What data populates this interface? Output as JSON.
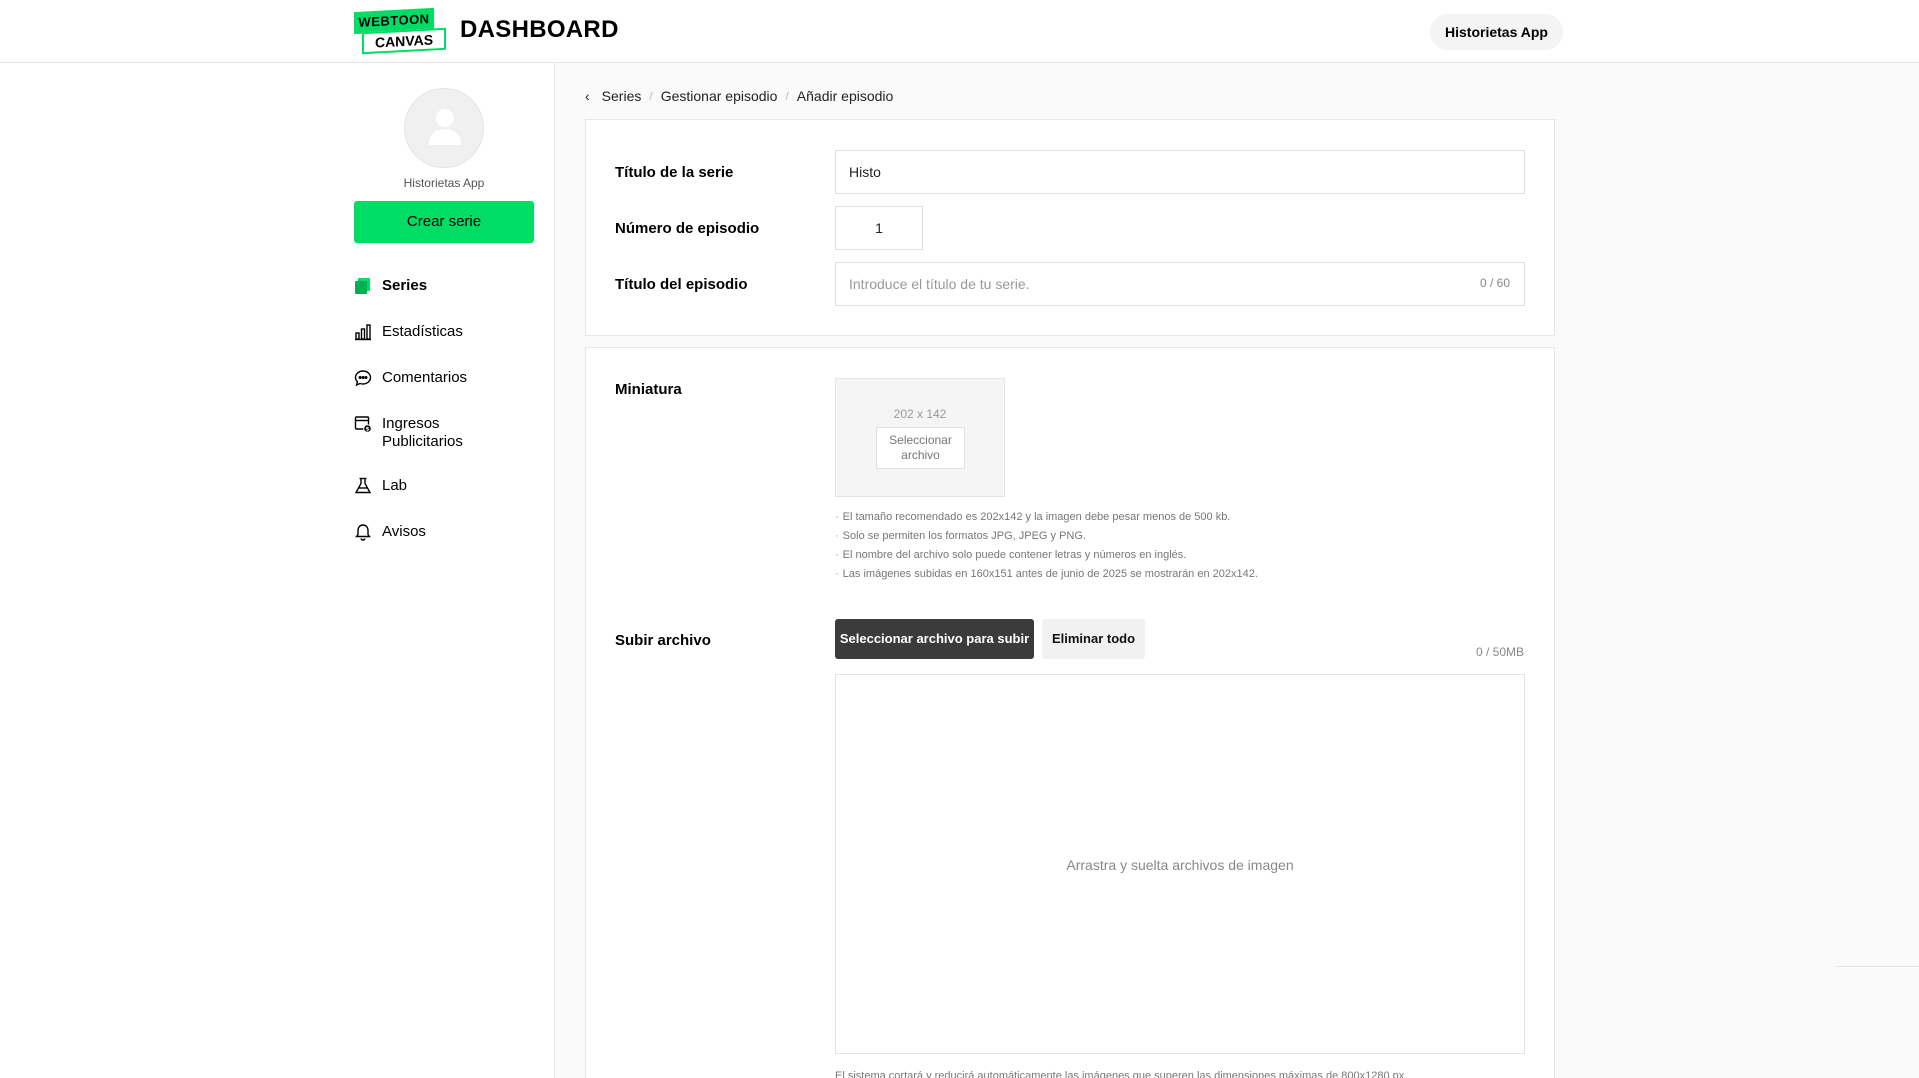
{
  "header": {
    "logo_top": "WEBTOON",
    "logo_bottom": "CANVAS",
    "title": "DASHBOARD",
    "user_button": "Historietas App"
  },
  "sidebar": {
    "user_name": "Historietas App",
    "create_label": "Crear serie",
    "items": [
      {
        "label": "Series",
        "icon": "series-icon",
        "active": true
      },
      {
        "label": "Estadísticas",
        "icon": "stats-icon"
      },
      {
        "label": "Comentarios",
        "icon": "comments-icon"
      },
      {
        "label": "Ingresos",
        "label2": "Publicitarios",
        "icon": "ad-revenue-icon"
      },
      {
        "label": "Lab",
        "icon": "lab-flask-icon"
      },
      {
        "label": "Avisos",
        "icon": "bell-icon"
      }
    ]
  },
  "breadcrumb": {
    "items": [
      "Series",
      "Gestionar episodio",
      "Añadir episodio"
    ]
  },
  "form": {
    "series_title_label": "Título de la serie",
    "series_title_value": "Histo",
    "episode_number_label": "Número de episodio",
    "episode_number_value": "1",
    "episode_title_label": "Título del episodio",
    "episode_title_placeholder": "Introduce el título de tu serie.",
    "episode_title_counter": "0 / 60"
  },
  "thumbnail": {
    "label": "Miniatura",
    "size": "202 x 142",
    "button_line1": "Seleccionar",
    "button_line2": "archivo",
    "notes": [
      "El tamaño recomendado es 202x142 y la imagen debe pesar menos de 500 kb.",
      "Solo se permiten los formatos JPG, JPEG y PNG.",
      "El nombre del archivo solo puede contener letras y números en inglés.",
      "Las imágenes subidas en 160x151 antes de junio de 2025 se mostrarán en 202x142."
    ]
  },
  "upload": {
    "label": "Subir archivo",
    "select_button": "Seleccionar archivo para subir",
    "delete_button": "Eliminar todo",
    "size_counter": "0 / 50MB",
    "dropzone_text": "Arrastra y suelta archivos de imagen",
    "bottom_note": "El sistema cortará y reducirá automáticamente las imágenes que superen las dimensiones máximas de 800x1280 px."
  },
  "colors": {
    "brand_green": "#00dc64",
    "dark_button": "#3b3b3b"
  }
}
